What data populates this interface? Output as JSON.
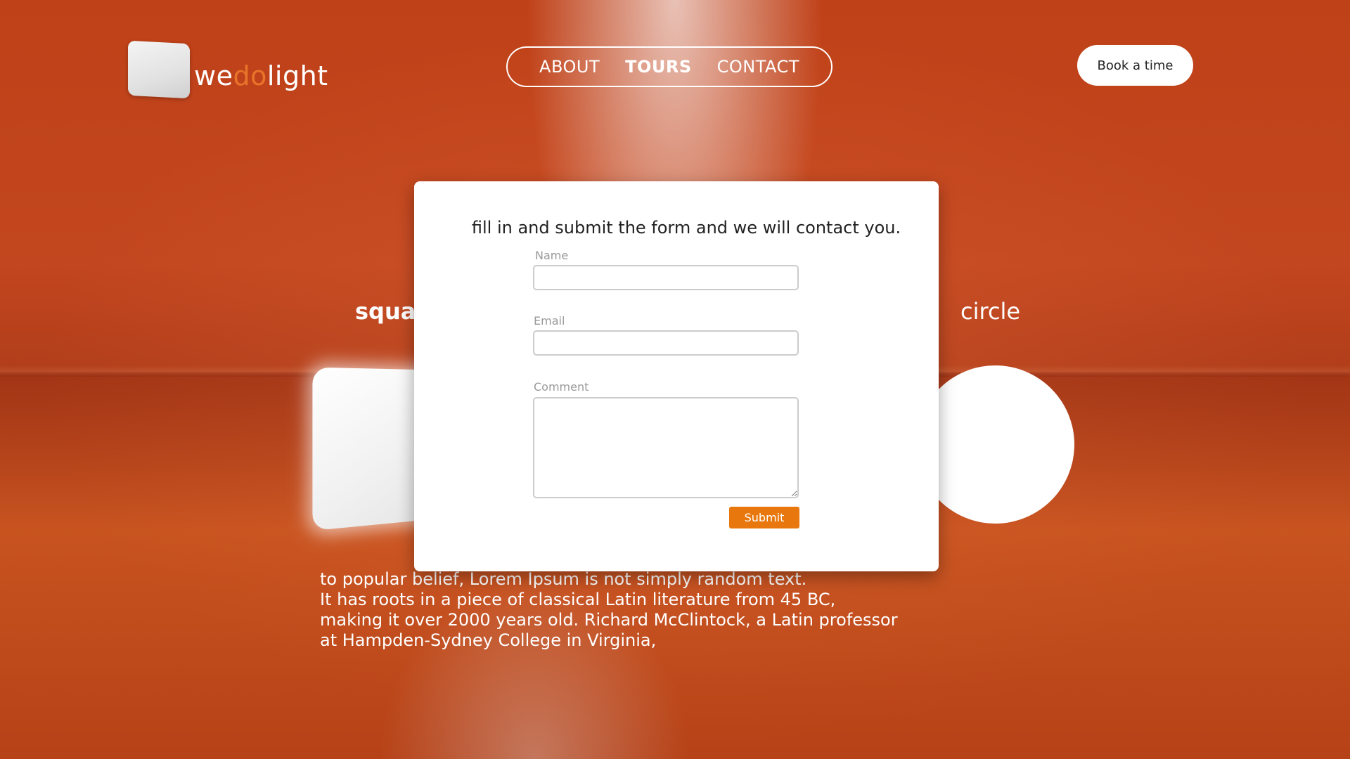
{
  "logo": {
    "part1": "we",
    "part2": "do",
    "part3": "light",
    "icon": "cube-logo-icon"
  },
  "nav": {
    "items": [
      {
        "label": "ABOUT"
      },
      {
        "label": "TOURS",
        "active": true
      },
      {
        "label": "CONTACT"
      }
    ]
  },
  "header": {
    "book_label": "Book a time"
  },
  "shapes": {
    "square_label": "square",
    "circle_label": "circle"
  },
  "body_text": {
    "lines": [
      "to popular belief, Lorem Ipsum is not simply random text.",
      "It has roots in a piece of classical Latin literature from 45 BC,",
      "making it over 2000 years old. Richard McClintock, a Latin professor",
      "at Hampden-Sydney College in Virginia,"
    ]
  },
  "modal": {
    "title": "fill in and submit the form and we will contact you.",
    "name_label": "Name",
    "name_value": "",
    "email_label": "Email",
    "email_value": "",
    "comment_label": "Comment",
    "comment_value": "",
    "submit_label": "Submit"
  },
  "colors": {
    "background": "#c2461f",
    "accent": "#e8780d",
    "logo_accent": "#e8742a"
  }
}
